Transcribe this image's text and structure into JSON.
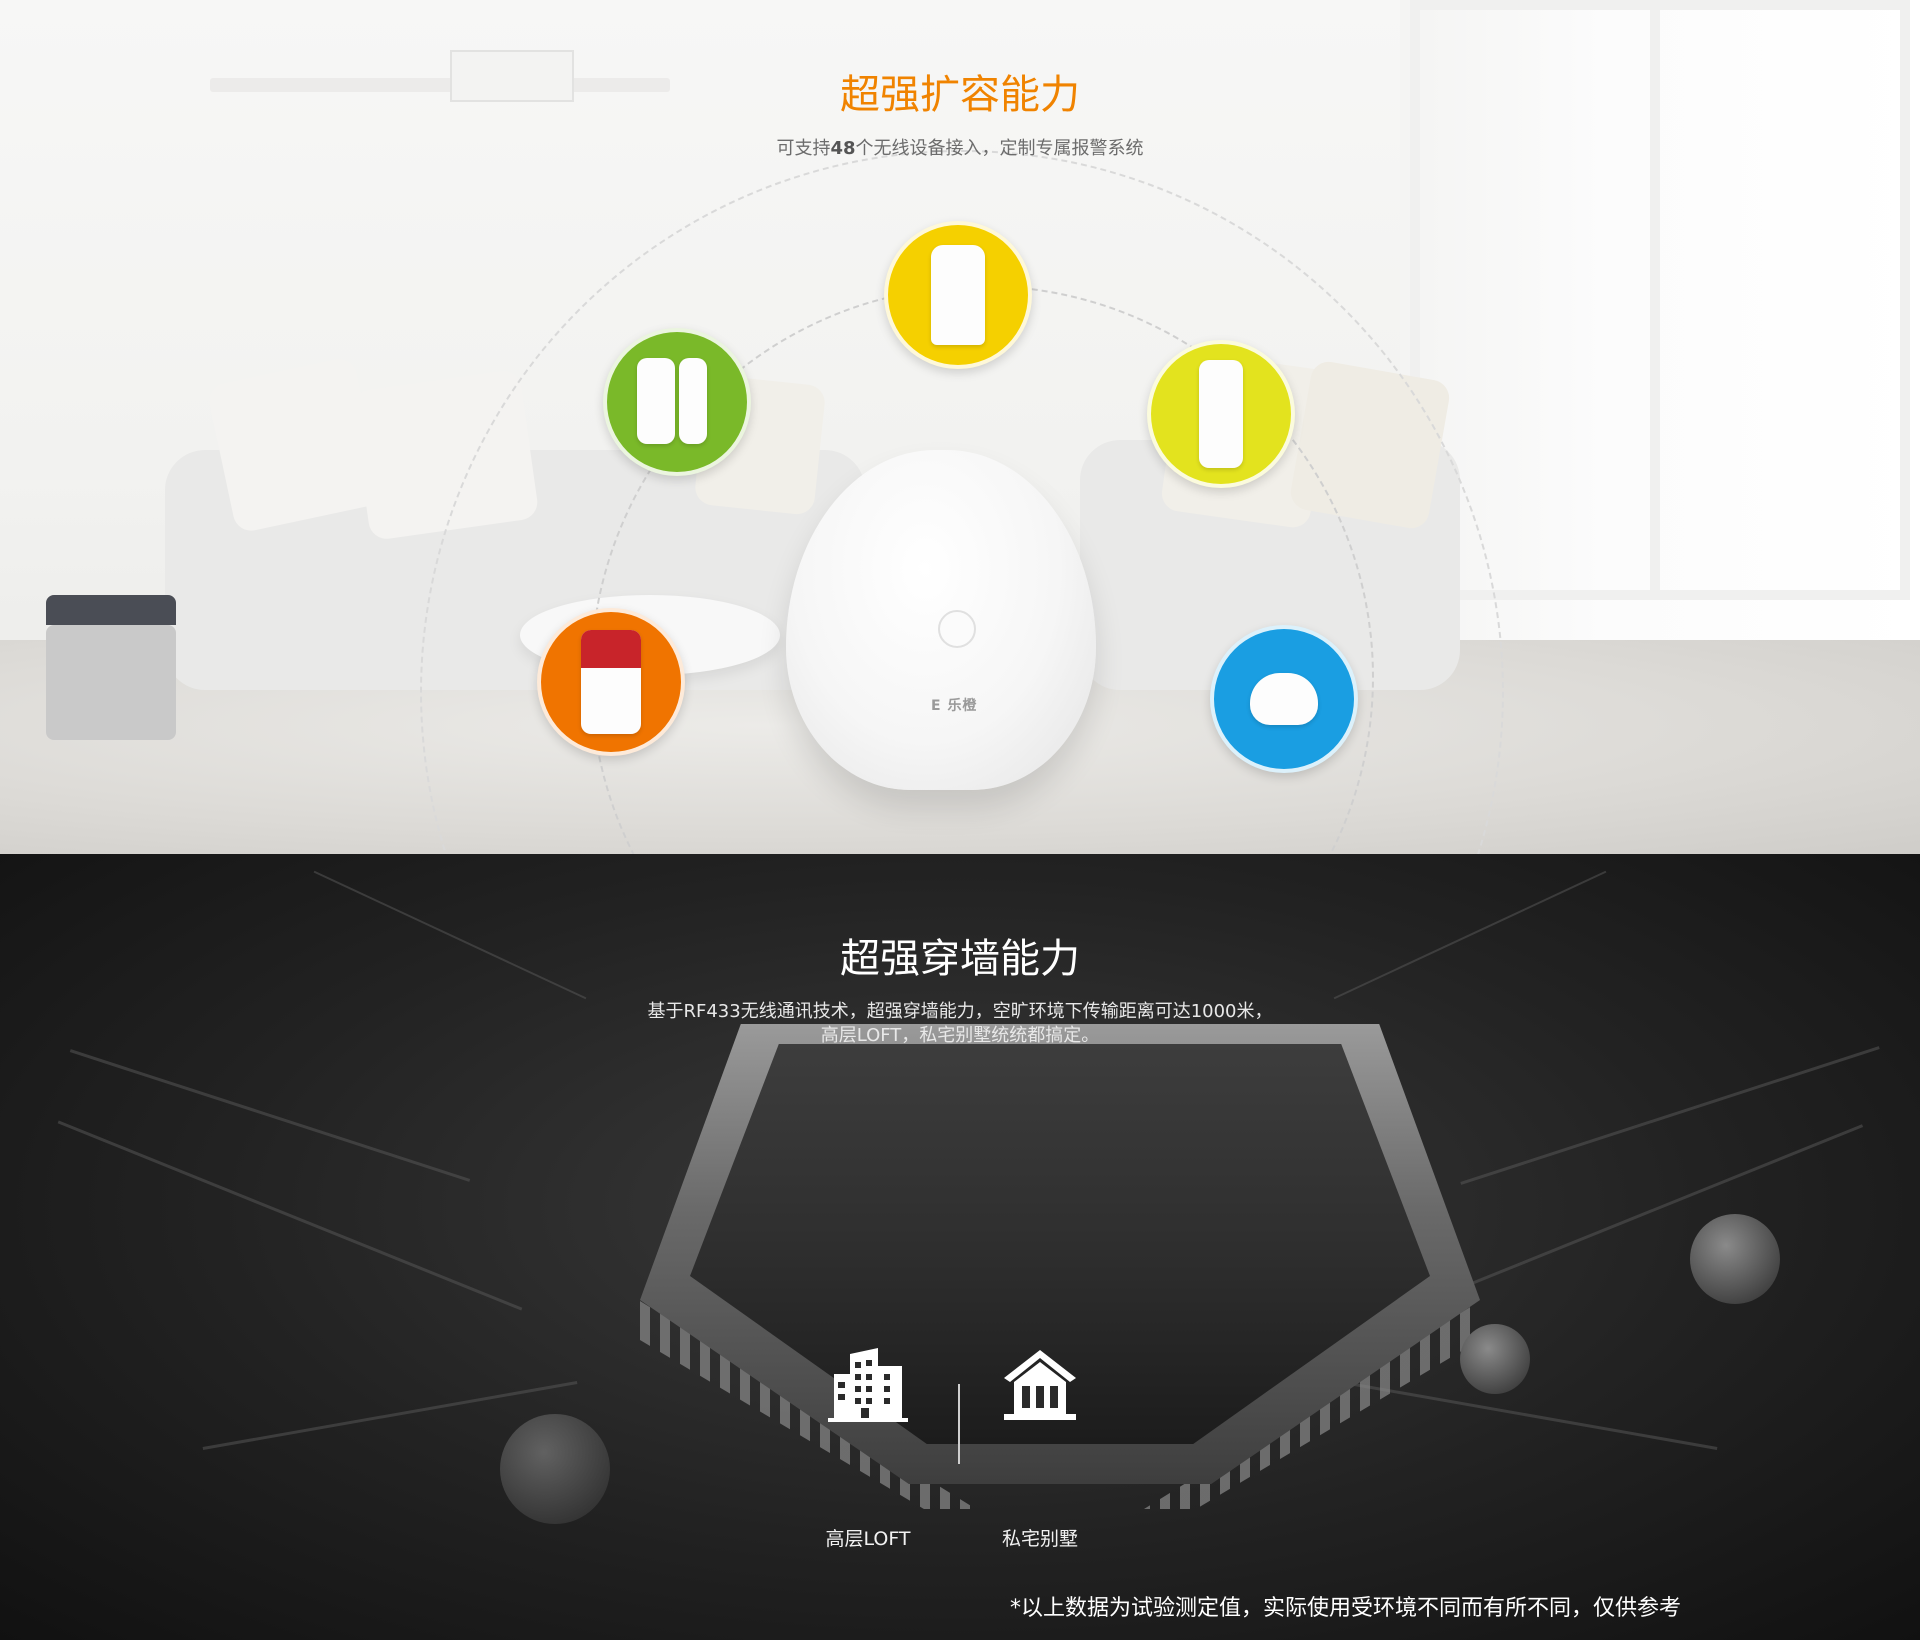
{
  "capacity": {
    "title": "超强扩容能力",
    "subtitle_prefix": "可支持",
    "subtitle_number": "48",
    "subtitle_suffix": "个无线设备接入，定制专属报警系统",
    "hub_logo": "E 乐橙",
    "devices": [
      {
        "name": "door-sensor",
        "color": "#7ab929"
      },
      {
        "name": "pir-motion-detector",
        "color": "#f5d000"
      },
      {
        "name": "curtain-detector",
        "color": "#e3e31e"
      },
      {
        "name": "siren",
        "color": "#f07400"
      },
      {
        "name": "sos-button",
        "color": "#1a9ee2"
      }
    ],
    "accent_color": "#f08300"
  },
  "penetration": {
    "title": "超强穿墙能力",
    "desc_line1": "基于RF433无线通讯技术，超强穿墙能力，空旷环境下传输距离可达1000米，",
    "desc_line2": "高层LOFT，私宅别墅统统都搞定。",
    "items": [
      {
        "label": "高层LOFT",
        "icon": "building-icon"
      },
      {
        "label": "私宅别墅",
        "icon": "house-icon"
      }
    ],
    "footnote": "*以上数据为试验测定值，实际使用受环境不同而有所不同，仅供参考"
  }
}
